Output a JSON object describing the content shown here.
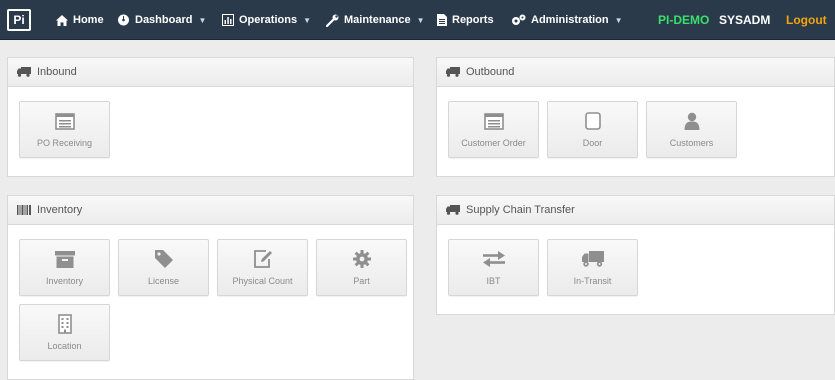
{
  "nav": {
    "logo": "Pi",
    "home": "Home",
    "dashboard": "Dashboard",
    "operations": "Operations",
    "maintenance": "Maintenance",
    "reports": "Reports",
    "administration": "Administration",
    "environment": "PI-DEMO",
    "user": "SYSADM",
    "logout": "Logout"
  },
  "colors": {
    "navbar": "#2b3a4b",
    "environment": "#38e06a",
    "logout": "#f0a60f",
    "icon": "#8f8f8f"
  },
  "panels": {
    "inbound": {
      "title": "Inbound",
      "icon": "truck-icon",
      "tiles": [
        {
          "label": "PO Receiving",
          "icon": "list-box-icon"
        }
      ]
    },
    "outbound": {
      "title": "Outbound",
      "icon": "truck-icon",
      "tiles": [
        {
          "label": "Customer Order",
          "icon": "list-box-icon"
        },
        {
          "label": "Door",
          "icon": "door-icon"
        },
        {
          "label": "Customers",
          "icon": "user-icon"
        }
      ]
    },
    "inventory": {
      "title": "Inventory",
      "icon": "barcode-icon",
      "tiles": [
        {
          "label": "Inventory",
          "icon": "archive-icon"
        },
        {
          "label": "License",
          "icon": "tag-icon"
        },
        {
          "label": "Physical Count",
          "icon": "edit-icon"
        },
        {
          "label": "Part",
          "icon": "gear-icon"
        },
        {
          "label": "Location",
          "icon": "building-icon"
        }
      ]
    },
    "supply_chain": {
      "title": "Supply Chain Transfer",
      "icon": "truck-icon",
      "tiles": [
        {
          "label": "IBT",
          "icon": "transfer-arrows-icon"
        },
        {
          "label": "In-Transit",
          "icon": "truck-icon"
        }
      ]
    }
  }
}
